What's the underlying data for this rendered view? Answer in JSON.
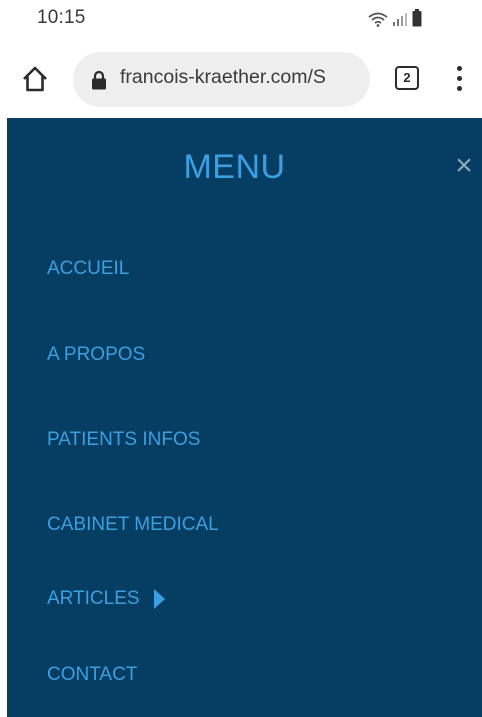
{
  "status_bar": {
    "time": "10:15",
    "icons": [
      "wifi-icon",
      "signal-icon",
      "battery-icon"
    ]
  },
  "browser": {
    "url": "francois-kraether.com/S",
    "tab_count": "2",
    "icons": [
      "home-icon",
      "lock-icon",
      "tabs-icon",
      "more-vert-icon"
    ]
  },
  "menu": {
    "title": "MENU",
    "close_label": "×",
    "items": [
      {
        "label": "ACCUEIL"
      },
      {
        "label": "A PROPOS"
      },
      {
        "label": "PATIENTS INFOS"
      },
      {
        "label": "CABINET MEDICAL"
      },
      {
        "label": "ARTICLES",
        "has_submenu": true
      },
      {
        "label": "CONTACT"
      }
    ]
  },
  "colors": {
    "menu_background": "#053e62",
    "menu_accent": "#3c9fe2",
    "url_bar_background": "#efefef"
  }
}
